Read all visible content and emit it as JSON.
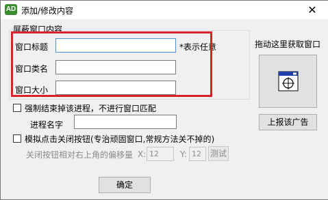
{
  "window": {
    "title": "添加/修改内容",
    "app_icon_text": "AD",
    "close_glyph": "✕"
  },
  "group": {
    "title": "屏蔽窗口内容"
  },
  "fields": {
    "window_title_label": "窗口标题",
    "window_title_value": "",
    "hint": "*表示任意",
    "class_name_label": "窗口类名",
    "class_name_value": "",
    "window_size_label": "窗口大小",
    "window_size_value": ""
  },
  "force_kill": {
    "label": "强制结束掉该进程，不进行窗口匹配",
    "checked": false,
    "process_name_label": "进程名字",
    "process_name_value": ""
  },
  "simulate_close": {
    "label": "模拟点击关闭按钮(专治顽固窗口,常规方法关不掉的)",
    "checked": false,
    "offset_label": "关闭按钮相对右上角的偏移量",
    "x_label": "X:",
    "x_value": "12",
    "y_label": "Y:",
    "y_value": "12",
    "test_label": "测试"
  },
  "side": {
    "drag_label": "拖动这里获取窗口",
    "drag_icon": "crosshair-window-icon",
    "report_label": "上报该广告"
  },
  "footer": {
    "ok_label": "确定"
  },
  "colors": {
    "highlight_border": "#d9212d",
    "focus_border": "#4d90d6"
  }
}
